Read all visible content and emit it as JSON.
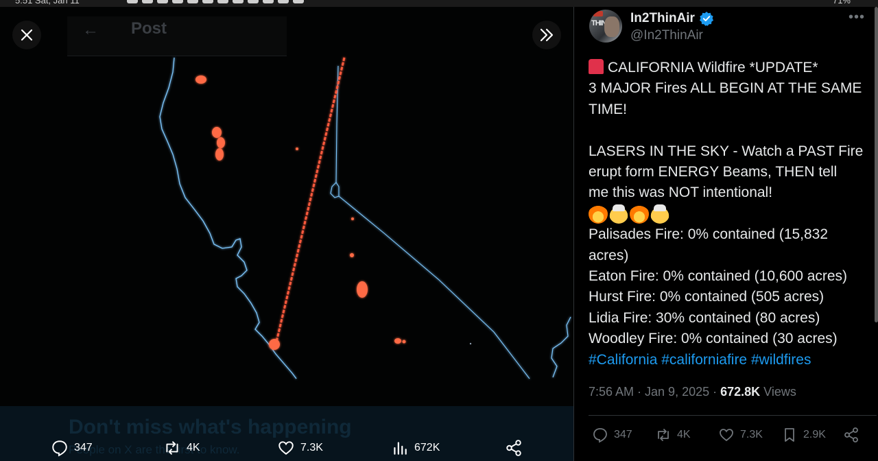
{
  "status_bar": {
    "time_date": "5:51  Sat, Jan 11",
    "battery": "71%"
  },
  "media": {
    "background_header_title": "Post",
    "background_banner_title": "Don't miss what's happening",
    "background_banner_subtitle": "People on X are the first to know.",
    "stats": {
      "replies": "347",
      "reposts": "4K",
      "likes": "7.3K",
      "views": "672K"
    }
  },
  "post": {
    "display_name": "In2ThinAir",
    "handle": "@In2ThinAir",
    "verified": true,
    "lines": [
      "CALIFORNIA Wildfire *UPDATE*",
      "3 MAJOR Fires ALL BEGIN AT THE SAME",
      "TIME!",
      "",
      "LASERS IN THE SKY - Watch a PAST Fire",
      "erupt form ENERGY Beams, THEN tell",
      "me this was NOT intentional!"
    ],
    "fire_list": [
      "Palisades Fire: 0% contained (15,832",
      "acres)",
      "Eaton Fire: 0% contained (10,600 acres)",
      "Hurst Fire: 0% contained (505 acres)",
      "Lidia Fire: 30% contained (80 acres)",
      "Woodley Fire: 0% contained (30 acres)"
    ],
    "hashtags": "#California #californiafire #wildfires",
    "timestamp": "7:56 AM · Jan 9, 2025 · ",
    "views_count": "672.8K",
    "views_label": " Views",
    "stats": {
      "replies": "347",
      "reposts": "4K",
      "likes": "7.3K",
      "bookmarks": "2.9K"
    }
  },
  "colors": {
    "accent": "#1d9bf0",
    "coastline": "#7ec8ff",
    "fire": "#ff5a3c",
    "muted": "#71767b"
  }
}
